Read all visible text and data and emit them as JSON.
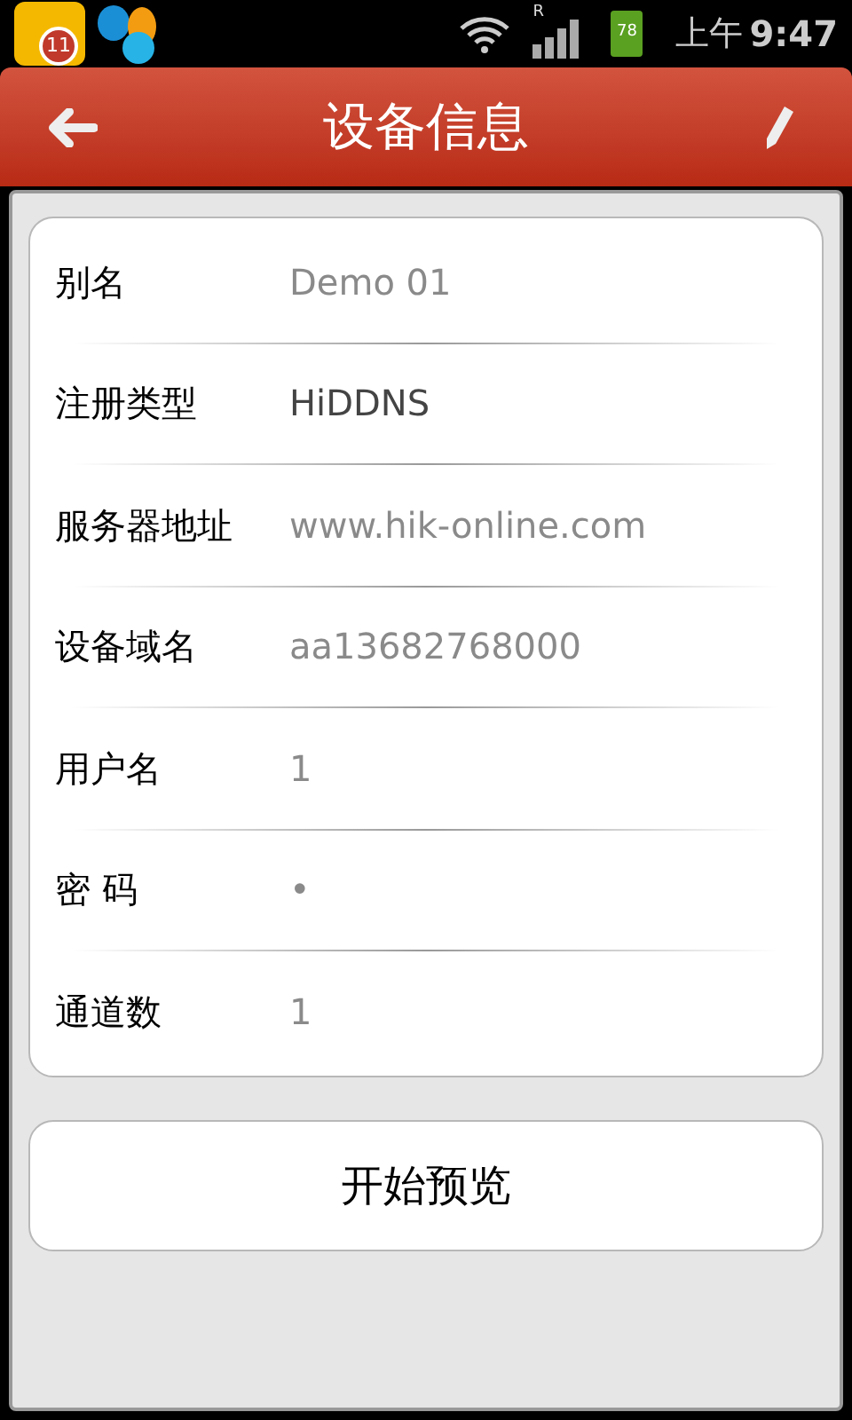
{
  "status_bar": {
    "notification_count": "11",
    "roaming": "R",
    "battery": "78",
    "period": "上午",
    "time": "9:47"
  },
  "header": {
    "title": "设备信息"
  },
  "fields": [
    {
      "label": "别名",
      "value": "Demo 01",
      "kind": "field"
    },
    {
      "label": "注册类型",
      "value": "HiDDNS",
      "kind": "choice"
    },
    {
      "label": "服务器地址",
      "value": "www.hik-online.com",
      "kind": "field"
    },
    {
      "label": "设备域名",
      "value": "aa13682768000",
      "kind": "field"
    },
    {
      "label": "用户名",
      "value": "1",
      "kind": "field"
    },
    {
      "label": "密 码",
      "value": "•",
      "kind": "field"
    },
    {
      "label": "通道数",
      "value": "1",
      "kind": "field"
    }
  ],
  "button": {
    "label": "开始预览"
  }
}
